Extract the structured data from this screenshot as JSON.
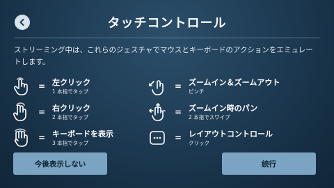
{
  "header": {
    "title": "タッチコントロール"
  },
  "description": "ストリーミング中は、これらのジェスチャでマウスとキーボードのアクションをエミュレートします。",
  "gestures_left": [
    {
      "icon": "one-finger-tap-icon",
      "eq": "=",
      "label": "左クリック",
      "sub": "1 本指でタップ"
    },
    {
      "icon": "two-finger-tap-icon",
      "eq": "=",
      "label": "右クリック",
      "sub": "2 本指でタップ"
    },
    {
      "icon": "three-finger-tap-icon",
      "eq": "=",
      "label": "キーボードを表示",
      "sub": "3 本指でタップ"
    }
  ],
  "gestures_right": [
    {
      "icon": "pinch-zoom-icon",
      "eq": "=",
      "label": "ズームイン＆ズームアウト",
      "sub": "ピンチ"
    },
    {
      "icon": "two-finger-swipe-icon",
      "eq": "=",
      "label": "ズームイン時のパン",
      "sub": "2 本指でスワイプ"
    },
    {
      "icon": "layout-control-icon",
      "eq": "=",
      "label": "レイアウトコントロール",
      "sub": "クリック"
    }
  ],
  "buttons": {
    "dont_show": "今後表示しない",
    "continue": "続行"
  },
  "colors": {
    "button_bg": "#7aa4c2",
    "background": "#1f3c55"
  }
}
